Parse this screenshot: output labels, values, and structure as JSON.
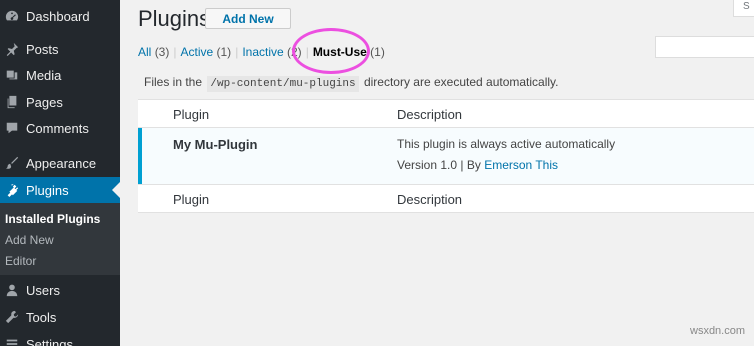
{
  "sidebar": {
    "items": [
      {
        "label": "Dashboard",
        "icon": "dashboard-icon"
      },
      {
        "label": "Posts",
        "icon": "pin-icon"
      },
      {
        "label": "Media",
        "icon": "media-icon"
      },
      {
        "label": "Pages",
        "icon": "pages-icon"
      },
      {
        "label": "Comments",
        "icon": "comment-icon"
      },
      {
        "label": "Appearance",
        "icon": "brush-icon"
      },
      {
        "label": "Plugins",
        "icon": "plug-icon",
        "active": true
      },
      {
        "label": "Users",
        "icon": "user-icon"
      },
      {
        "label": "Tools",
        "icon": "wrench-icon"
      },
      {
        "label": "Settings",
        "icon": "settings-icon"
      }
    ],
    "submenu": [
      {
        "label": "Installed Plugins",
        "current": true
      },
      {
        "label": "Add New"
      },
      {
        "label": "Editor"
      }
    ]
  },
  "header": {
    "title": "Plugins",
    "add_new_label": "Add New",
    "screen_options_label": "S"
  },
  "filters": {
    "all_label": "All",
    "all_count": "(3)",
    "active_label": "Active",
    "active_count": "(1)",
    "inactive_label": "Inactive",
    "inactive_count": "(2)",
    "mustuse_label": "Must-Use",
    "mustuse_count": "(1)",
    "separator": "|"
  },
  "note": {
    "prefix": "Files in the",
    "path": "/wp-content/mu-plugins",
    "suffix": "directory are executed automatically."
  },
  "table": {
    "col_plugin": "Plugin",
    "col_description": "Description",
    "rows": [
      {
        "name": "My Mu-Plugin",
        "description": "This plugin is always active automatically",
        "version_text": "Version 1.0 | By",
        "author": "Emerson This"
      }
    ]
  },
  "colors": {
    "sidebar_bg": "#23282d",
    "accent": "#0073aa",
    "highlight_oval": "#ec4fe0",
    "active_row_border": "#00a0d2"
  },
  "watermark": "wsxdn.com"
}
